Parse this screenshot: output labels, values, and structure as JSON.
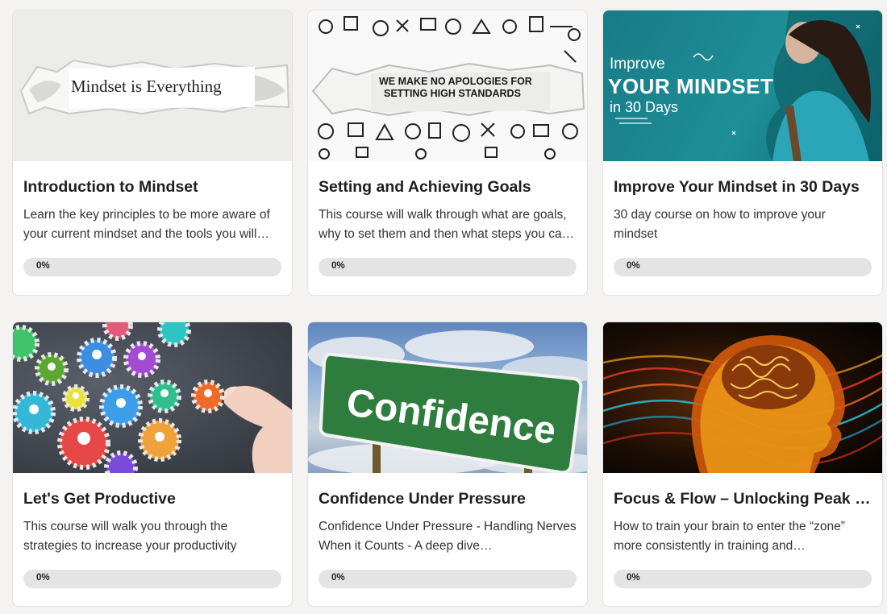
{
  "courses": [
    {
      "title": "Introduction to Mindset",
      "description": "Learn the key principles to be more aware of your current mindset and the tools you will…",
      "progress_label": "0%",
      "progress": 0,
      "image_text": "Mindset is Everything"
    },
    {
      "title": "Setting and Achieving Goals",
      "description": "This course will walk through what are goals, why to set them and then what steps you ca…",
      "progress_label": "0%",
      "progress": 0,
      "image_text_1": "WE MAKE NO APOLOGIES FOR",
      "image_text_2": "SETTING HIGH STANDARDS"
    },
    {
      "title": "Improve Your Mindset in 30 Days",
      "description": "30 day course on how to improve your mindset",
      "progress_label": "0%",
      "progress": 0,
      "image_text_1": "Improve",
      "image_text_2": "YOUR MINDSET",
      "image_text_3": "in 30 Days"
    },
    {
      "title": "Let's Get Productive",
      "description": "This course will walk you through the strategies to increase your productivity",
      "progress_label": "0%",
      "progress": 0
    },
    {
      "title": "Confidence Under Pressure",
      "description": "Confidence Under Pressure - Handling Nerves When it Counts - A deep dive…",
      "progress_label": "0%",
      "progress": 0,
      "image_text": "Confidence"
    },
    {
      "title": "Focus & Flow – Unlocking Peak P…",
      "description": "How to train your brain to enter the “zone” more consistently in training and…",
      "progress_label": "0%",
      "progress": 0
    }
  ],
  "colors": {
    "page_background": "#f4f3f2",
    "card_background": "#ffffff",
    "progress_track": "#e4e4e4",
    "title_text": "#1f1f1f"
  }
}
